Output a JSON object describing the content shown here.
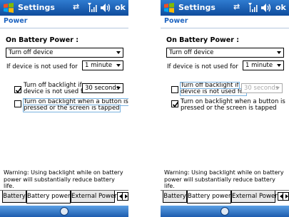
{
  "screens": [
    {
      "title": "Settings",
      "ok_label": "ok",
      "page_header": "Power",
      "section_label": "On Battery Power :",
      "power_off_select": "Turn off device",
      "inactive_label": "If device is not used for",
      "inactive_select": "1 minute",
      "backlight_checked": true,
      "backlight_line1": "Turn off backlight if",
      "backlight_line2": "device is not used for",
      "backlight_select": "30 seconds",
      "backlight_select_disabled": false,
      "button_backlight_checked": false,
      "button_line1": "Turn on backlight when a button is",
      "button_line2": "pressed or the screen is tapped",
      "warning_line1": "Warning: Using backlight while on battery",
      "warning_line2": "power will substantially reduce battery life.",
      "tabs": [
        "Battery",
        "Battery power",
        "External Power"
      ],
      "active_tab": "Battery power"
    },
    {
      "title": "Settings",
      "ok_label": "ok",
      "page_header": "Power",
      "section_label": "On Battery Power :",
      "power_off_select": "Turn off device",
      "inactive_label": "If device is not used for",
      "inactive_select": "1 minute",
      "backlight_checked": false,
      "backlight_line1": "Turn off backlight if",
      "backlight_line2": "device is not used for",
      "backlight_select": "30 seconds",
      "backlight_select_disabled": true,
      "button_backlight_checked": true,
      "button_line1": "Turn on backlight when a button is",
      "button_line2": "pressed or the screen is tapped",
      "warning_line1": "Warning: Using backlight while on battery",
      "warning_line2": "power will substantially reduce battery life.",
      "tabs": [
        "Battery",
        "Battery power",
        "External Power"
      ],
      "active_tab": "Battery power"
    }
  ],
  "colors": {
    "titlebar": "#1a5fb4",
    "header_text": "#1c63c0",
    "focus_outline": "#79b2e0"
  },
  "icons": {
    "start": "windows-flag-icon",
    "sync": "sync-arrows-icon",
    "signal": "signal-strength-icon",
    "volume": "speaker-icon",
    "sip": "keyboard-icon"
  }
}
